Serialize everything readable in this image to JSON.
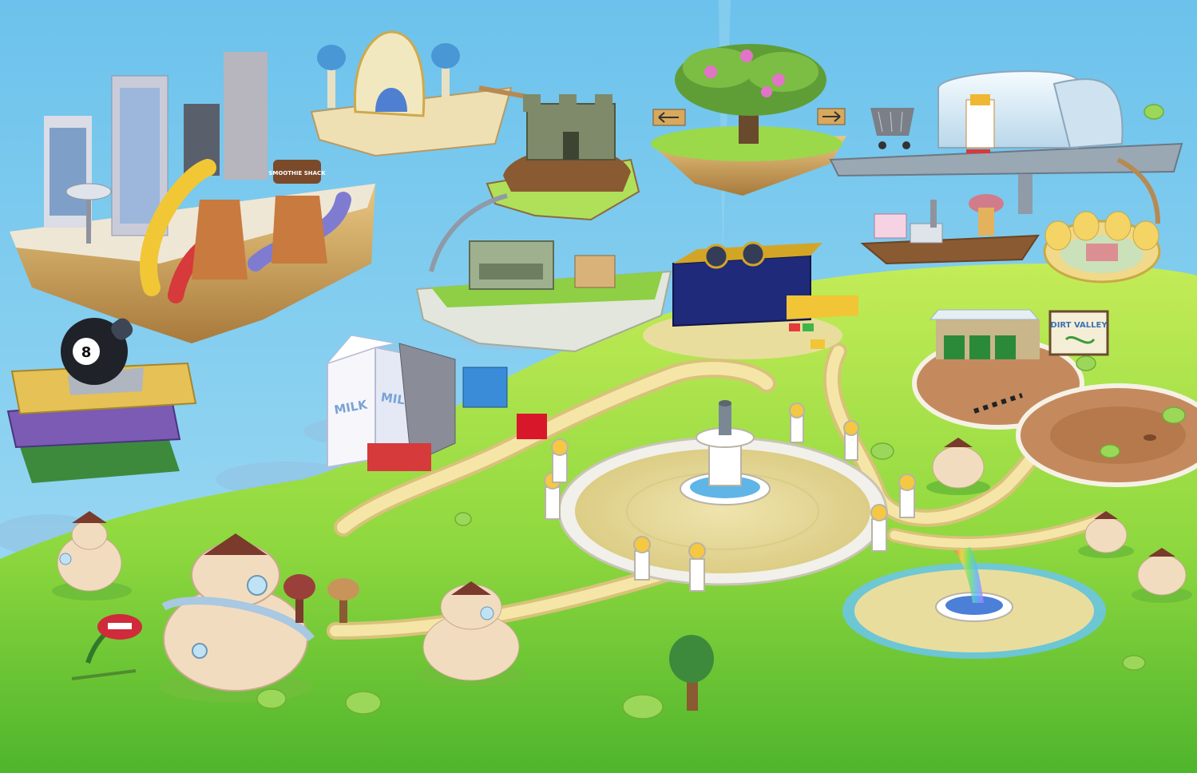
{
  "colors": {
    "sky_top": "#6cc2ec",
    "sky_bottom": "#a6def4",
    "grass_light": "#b9e84a",
    "grass_dark": "#5fc12f",
    "path": "#f5e6a8",
    "path_edge": "#d8c27a",
    "plaza_stone": "#f2f0ea",
    "plaza_sand": "#e9dd9e",
    "dirt_track": "#c48a5e",
    "floating_rock": "#d2a85d",
    "water": "#6bc5ee",
    "mall_glass": "#dfeff8"
  },
  "map": {
    "signs": {
      "smoothie": "SMOOTHIE SHACK",
      "milk_left": "MILK",
      "milk_right": "MILK",
      "eight_ball": "8",
      "dirt_valley": "DIRT VALLEY"
    },
    "icons": [
      "fountain-icon",
      "rainbow-fountain-icon",
      "pod-house-icon",
      "shopping-cart-icon",
      "arrow-left-icon",
      "arrow-right-icon",
      "tree-icon",
      "castle-icon",
      "milk-carton-icon",
      "eight-ball-icon",
      "books-icon",
      "arena-icon",
      "mall-icon",
      "chomper-plant-icon"
    ]
  }
}
